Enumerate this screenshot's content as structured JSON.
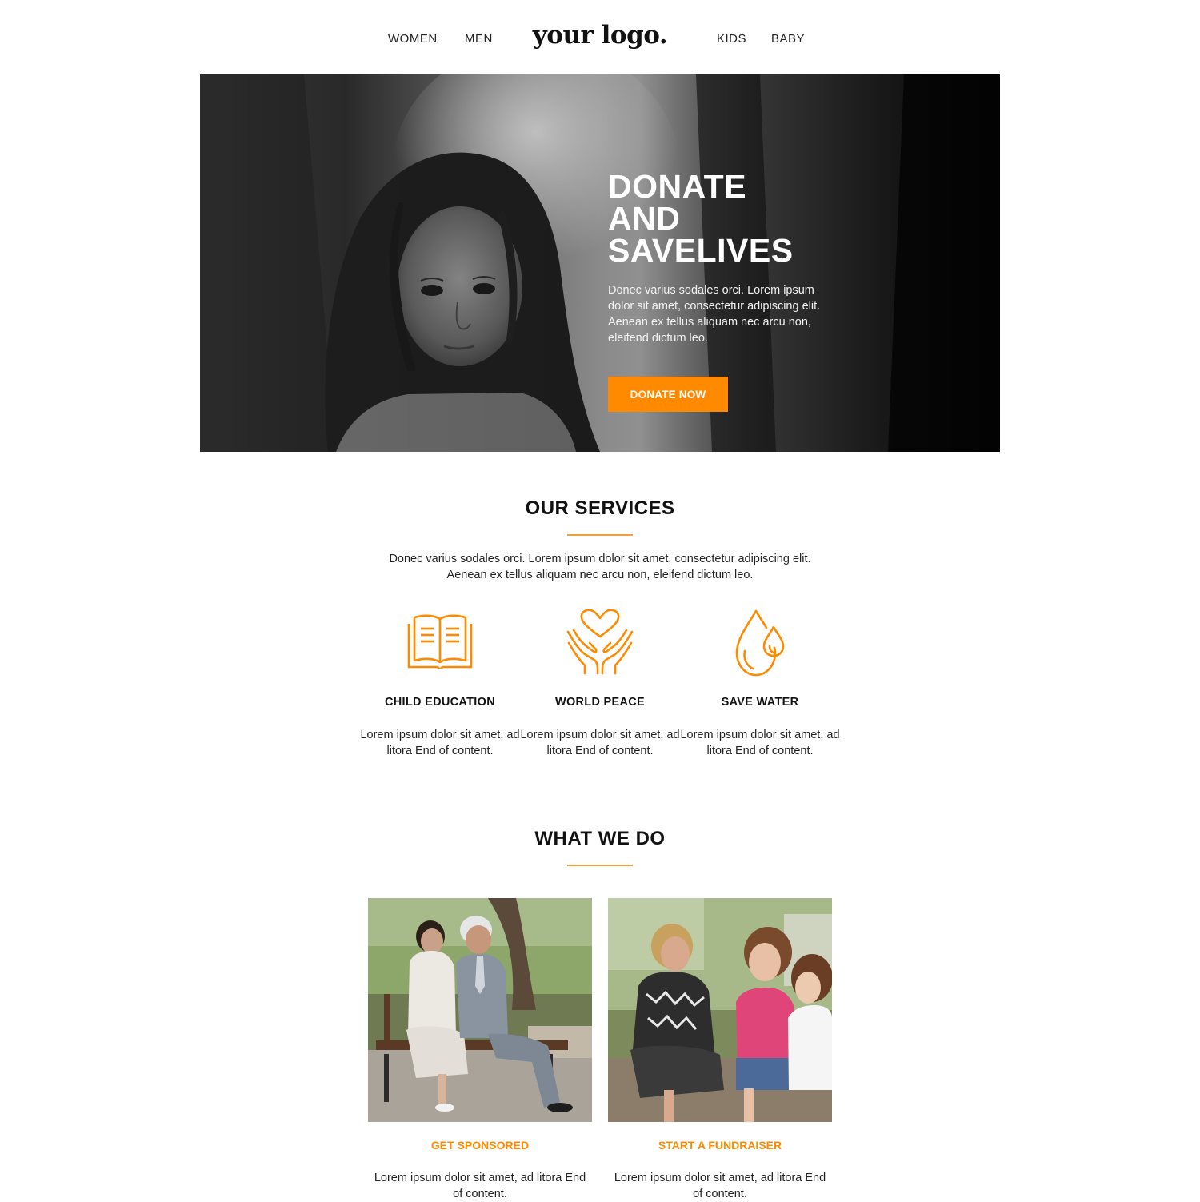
{
  "nav": {
    "items": [
      "WOMEN",
      "MEN",
      "KIDS",
      "BABY"
    ],
    "logo": "your logo."
  },
  "hero": {
    "title_lines": [
      "DONATE",
      "AND",
      "SAVELIVES"
    ],
    "text": "Donec varius sodales orci. Lorem ipsum dolor sit amet, consectetur adipiscing elit. Aenean ex tellus aliquam nec arcu non, eleifend dictum leo.",
    "button_label": "DONATE NOW",
    "button_color": "#ff8a00"
  },
  "services": {
    "title": "OUR SERVICES",
    "intro_lines": [
      "Donec varius sodales orci. Lorem ipsum dolor sit amet, consectetur adipiscing elit.",
      "Aenean ex tellus aliquam nec arcu non, eleifend dictum leo."
    ],
    "items": [
      {
        "icon": "book-icon",
        "title": "CHILD EDUCATION",
        "text": "Lorem ipsum dolor sit amet, ad litora End of content."
      },
      {
        "icon": "heart-hands-icon",
        "title": "WORLD PEACE",
        "text": "Lorem ipsum dolor sit amet, ad litora End of content."
      },
      {
        "icon": "water-drop-icon",
        "title": "SAVE WATER",
        "text": "Lorem ipsum dolor sit amet, ad litora End of content."
      }
    ],
    "accent_color": "#ff8a00"
  },
  "what_we_do": {
    "title": "WHAT WE DO",
    "cards": [
      {
        "title": "GET SPONSORED",
        "text": "Lorem ipsum dolor sit amet, ad litora End of content."
      },
      {
        "title": "START A FUNDRAISER",
        "text": "Lorem ipsum dolor sit amet, ad litora End of content."
      }
    ]
  }
}
